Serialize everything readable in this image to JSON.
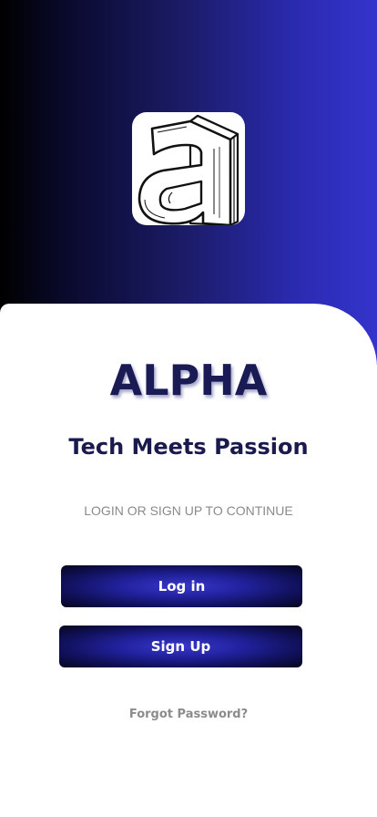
{
  "colors": {
    "hero_gradient_start": "#000000",
    "hero_gradient_end": "#3434cc",
    "brand_text": "#1a1a55",
    "button_center": "#3838c8",
    "button_edge": "#06061e",
    "muted_text": "#8a8a8a"
  },
  "logo": {
    "icon": "alpha-a-logo-icon"
  },
  "brand": {
    "name": "ALPHA",
    "tagline": "Tech Meets Passion"
  },
  "auth": {
    "hint": "LOGIN OR SIGN UP TO CONTINUE",
    "login_label": "Log in",
    "signup_label": "Sign Up",
    "forgot_label": "Forgot Password?"
  }
}
